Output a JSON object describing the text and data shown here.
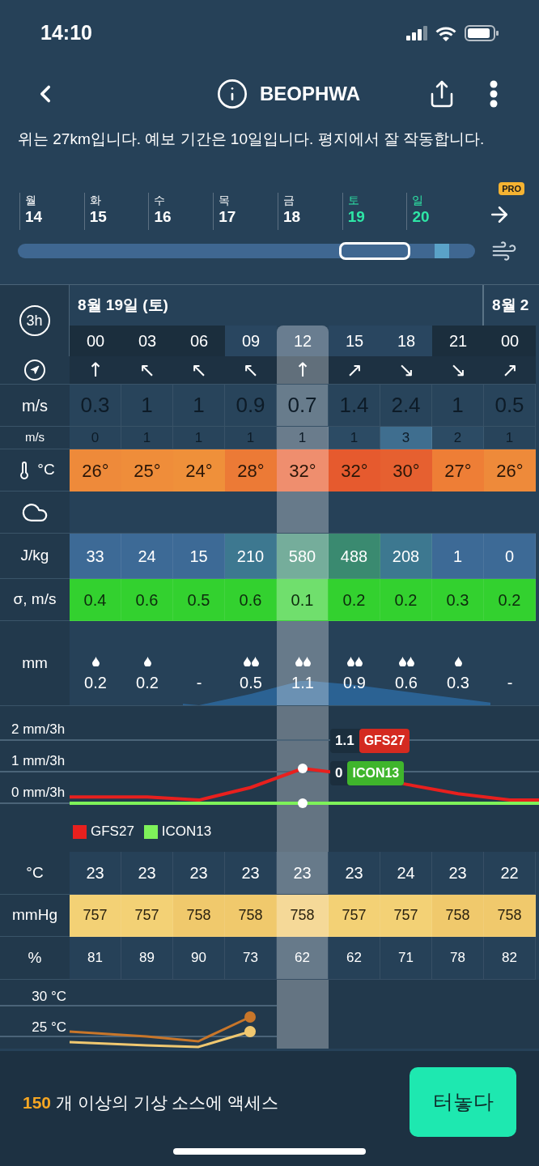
{
  "status_bar": {
    "time": "14:10"
  },
  "header": {
    "title": "BEOPHWA"
  },
  "description": "위는 27km입니다. 예보 기간은 10일입니다. 평지에서 잘 작동합니다.",
  "days": [
    {
      "weekday": "월",
      "day": "14",
      "weekend": false
    },
    {
      "weekday": "화",
      "day": "15",
      "weekend": false
    },
    {
      "weekday": "수",
      "day": "16",
      "weekend": false
    },
    {
      "weekday": "목",
      "day": "17",
      "weekend": false
    },
    {
      "weekday": "금",
      "day": "18",
      "weekend": false
    },
    {
      "weekday": "토",
      "day": "19",
      "weekend": true
    },
    {
      "weekday": "일",
      "day": "20",
      "weekend": true
    }
  ],
  "pro_badge": "PRO",
  "timeline": {
    "level": 0.78
  },
  "table": {
    "interval": "3h",
    "columns": [
      {
        "hour": "00",
        "night": true,
        "selected": false,
        "date": "8월 19일 (토)"
      },
      {
        "hour": "03",
        "night": true,
        "selected": false
      },
      {
        "hour": "06",
        "night": true,
        "selected": false
      },
      {
        "hour": "09",
        "night": false,
        "selected": false
      },
      {
        "hour": "12",
        "night": false,
        "selected": true
      },
      {
        "hour": "15",
        "night": false,
        "selected": false
      },
      {
        "hour": "18",
        "night": false,
        "selected": false
      },
      {
        "hour": "21",
        "night": true,
        "selected": false
      },
      {
        "hour": "00",
        "night": true,
        "selected": false,
        "date": "8월 2"
      }
    ],
    "rows": [
      {
        "kind": "direction",
        "cells": [
          "↑",
          "↖",
          "↖",
          "↖",
          "↑",
          "↗",
          "↘",
          "↘",
          "↗"
        ]
      },
      {
        "kind": "wind",
        "label": "m/s",
        "cells": [
          "0.3",
          "1",
          "1",
          "0.9",
          "0.7",
          "1.4",
          "2.4",
          "1",
          "0.5"
        ]
      },
      {
        "kind": "gust",
        "label": "m/s",
        "cells": [
          {
            "text": "0",
            "color": "#28445b"
          },
          {
            "text": "1",
            "color": "#28445b"
          },
          {
            "text": "1",
            "color": "#28445b"
          },
          {
            "text": "1",
            "color": "#28445b"
          },
          {
            "text": "1",
            "color": "#6a7c8c"
          },
          {
            "text": "1",
            "color": "#2c4b64"
          },
          {
            "text": "3",
            "color": "#3f6e8f"
          },
          {
            "text": "2",
            "color": "#2c4b64"
          },
          {
            "text": "1",
            "color": "#28445b"
          }
        ]
      },
      {
        "kind": "temperature",
        "label": "°C",
        "cells": [
          {
            "text": "26°",
            "color": "#ee8a3a"
          },
          {
            "text": "25°",
            "color": "#ef8d3a"
          },
          {
            "text": "24°",
            "color": "#ef903a"
          },
          {
            "text": "28°",
            "color": "#ec7a36"
          },
          {
            "text": "32°",
            "color": "#ef8e6e"
          },
          {
            "text": "32°",
            "color": "#e65a2e"
          },
          {
            "text": "30°",
            "color": "#e66030"
          },
          {
            "text": "27°",
            "color": "#ee7e36"
          },
          {
            "text": "26°",
            "color": "#ee8a3a"
          }
        ]
      },
      {
        "kind": "cloud"
      },
      {
        "kind": "cape",
        "label": "J/kg",
        "cells": [
          {
            "text": "33",
            "color": "#3d6a96"
          },
          {
            "text": "24",
            "color": "#3d6a96"
          },
          {
            "text": "15",
            "color": "#3d6a96"
          },
          {
            "text": "210",
            "color": "#3d7890"
          },
          {
            "text": "580",
            "color": "#75ad9b"
          },
          {
            "text": "488",
            "color": "#3a8a70"
          },
          {
            "text": "208",
            "color": "#3d7890"
          },
          {
            "text": "1",
            "color": "#3d6a96"
          },
          {
            "text": "0",
            "color": "#3d6a96"
          }
        ]
      },
      {
        "kind": "sigma",
        "label": "σ, m/s",
        "cells": [
          "0.4",
          "0.6",
          "0.5",
          "0.6",
          "0.1",
          "0.2",
          "0.2",
          "0.3",
          "0.2"
        ]
      },
      {
        "kind": "precip",
        "label": "mm",
        "cells": [
          "0.2",
          "0.2",
          "-",
          "0.5",
          "1.1",
          "0.9",
          "0.6",
          "0.3",
          "-"
        ]
      },
      {
        "kind": "precip-chart",
        "ticks": [
          "2 mm/3h",
          "1 mm/3h",
          "0 mm/3h"
        ],
        "models": [
          {
            "name": "GFS27",
            "color": "#e8201e"
          },
          {
            "name": "ICON13",
            "color": "#7ef25a"
          }
        ],
        "tooltips": [
          {
            "value": "1.1",
            "label": "GFS27",
            "color": "#d42a20"
          },
          {
            "value": "0",
            "label": "ICON13",
            "color": "#3fb52c"
          }
        ]
      },
      {
        "kind": "legend"
      },
      {
        "kind": "air-temp",
        "label": "°C",
        "cells": [
          "23",
          "23",
          "23",
          "23",
          "23",
          "23",
          "24",
          "23",
          "22"
        ]
      },
      {
        "kind": "pressure",
        "label": "mmHg",
        "cells": [
          {
            "text": "757",
            "color": "#f3d175"
          },
          {
            "text": "757",
            "color": "#f3d175"
          },
          {
            "text": "758",
            "color": "#f0c96c"
          },
          {
            "text": "758",
            "color": "#f0c96c"
          },
          {
            "text": "758",
            "color": "#f5d998"
          },
          {
            "text": "757",
            "color": "#f3d175"
          },
          {
            "text": "757",
            "color": "#f3d175"
          },
          {
            "text": "758",
            "color": "#f0c96c"
          },
          {
            "text": "758",
            "color": "#f0c96c"
          }
        ]
      },
      {
        "kind": "humidity",
        "label": "%",
        "cells": [
          "81",
          "89",
          "90",
          "73",
          "62",
          "62",
          "71",
          "78",
          "82"
        ]
      },
      {
        "kind": "temp-chart",
        "ticks": [
          "30 °C",
          "25 °C"
        ]
      }
    ]
  },
  "banner": {
    "count": "150",
    "text": "개 이상의 기상 소스에 액세스",
    "button": "터놓다"
  }
}
